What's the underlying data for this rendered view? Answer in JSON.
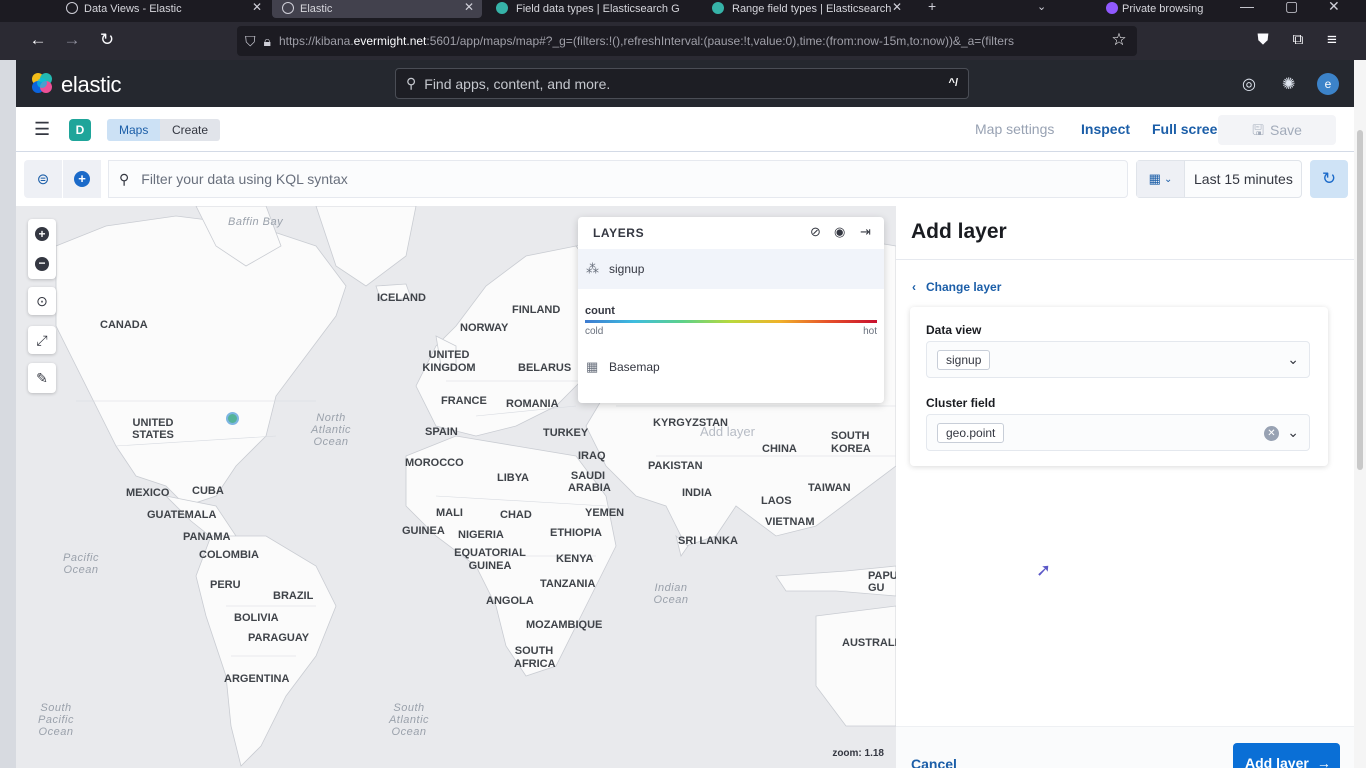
{
  "browser": {
    "tabs": [
      {
        "title": "Data Views - Elastic",
        "active": false
      },
      {
        "title": "Elastic",
        "active": true
      },
      {
        "title": "Field data types | Elasticsearch G",
        "active": false
      },
      {
        "title": "Range field types | Elasticsearch",
        "active": false
      }
    ],
    "private_label": "Private browsing",
    "url_prefix": "https://kibana.",
    "url_host": "evermight.net",
    "url_rest": ":5601/app/maps/map#?_g=(filters:!(),refreshInterval:(pause:!t,value:0),time:(from:now-15m,to:now))&_a=(filters"
  },
  "header": {
    "logo_text": "elastic",
    "search_placeholder": "Find apps, content, and more.",
    "search_shortcut": "^/",
    "avatar_letter": "e"
  },
  "appbar": {
    "space_letter": "D",
    "breadcrumbs": [
      "Maps",
      "Create"
    ],
    "links": {
      "map_settings": "Map settings",
      "inspect": "Inspect",
      "full_screen": "Full screen",
      "save": "Save"
    }
  },
  "query": {
    "placeholder": "Filter your data using KQL syntax",
    "time_range": "Last 15 minutes"
  },
  "map": {
    "zoom_label": "zoom: 1.18",
    "labels": [
      "CANADA",
      "UNITED STATES",
      "MEXICO",
      "CUBA",
      "GUATEMALA",
      "PANAMA",
      "COLOMBIA",
      "PERU",
      "BRAZIL",
      "BOLIVIA",
      "PARAGUAY",
      "ARGENTINA",
      "ICELAND",
      "NORWAY",
      "FINLAND",
      "UNITED KINGDOM",
      "BELARUS",
      "FRANCE",
      "ROMANIA",
      "SPAIN",
      "TURKEY",
      "MOROCCO",
      "LIBYA",
      "IRAQ",
      "SAUDI ARABIA",
      "MALI",
      "CHAD",
      "NIGERIA",
      "GUINEA",
      "YEMEN",
      "ETHIOPIA",
      "EQUATORIAL GUINEA",
      "KENYA",
      "TANZANIA",
      "ANGOLA",
      "MOZAMBIQUE",
      "SOUTH AFRICA",
      "KYRGYZSTAN",
      "PAKISTAN",
      "INDIA",
      "CHINA",
      "SOUTH KOREA",
      "TAIWAN",
      "LAOS",
      "VIETNAM",
      "SRI LANKA",
      "PAPU GU",
      "AUSTRALIA"
    ],
    "oceans": [
      "Baffin Bay",
      "North Atlantic Ocean",
      "Pacific Ocean",
      "Indian Ocean",
      "South Pacific Ocean",
      "South Atlantic Ocean"
    ]
  },
  "layers_panel": {
    "title": "LAYERS",
    "layers": [
      {
        "name": "signup",
        "icon": "cluster-icon"
      },
      {
        "name": "Basemap",
        "icon": "grid-icon"
      }
    ],
    "legend": {
      "field": "count",
      "min_label": "cold",
      "max_label": "hot"
    },
    "add_layer_ghost": "Add layer"
  },
  "flyout": {
    "title": "Add layer",
    "back_label": "Change layer",
    "data_view_label": "Data view",
    "data_view_value": "signup",
    "cluster_field_label": "Cluster field",
    "cluster_field_value": "geo.point",
    "cancel_label": "Cancel",
    "add_label": "Add layer"
  },
  "colors": {
    "accent": "#0a6fd6",
    "header_bg": "#25282f",
    "map_bg": "#e9eaed"
  }
}
